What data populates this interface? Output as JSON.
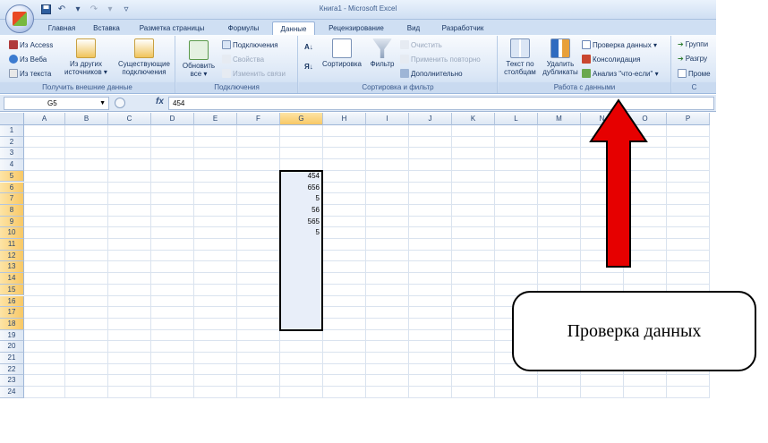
{
  "window": {
    "title": "Книга1 - Microsoft Excel"
  },
  "colors": {
    "accent": "#15325f",
    "selection_fill": "#e8eef9",
    "arrow_red": "#e60000"
  },
  "tabs": [
    {
      "label": "Главная",
      "active": false
    },
    {
      "label": "Вставка",
      "active": false
    },
    {
      "label": "Разметка страницы",
      "active": false
    },
    {
      "label": "Формулы",
      "active": false
    },
    {
      "label": "Данные",
      "active": true
    },
    {
      "label": "Рецензирование",
      "active": false
    },
    {
      "label": "Вид",
      "active": false
    },
    {
      "label": "Разработчик",
      "active": false
    }
  ],
  "ribbon": {
    "external": {
      "access": "Из Access",
      "web": "Из Веба",
      "text": "Из текста",
      "other_l1": "Из других",
      "other_l2": "источников ▾",
      "existing_l1": "Существующие",
      "existing_l2": "подключения",
      "label": "Получить внешние данные"
    },
    "connections": {
      "refresh_l1": "Обновить",
      "refresh_l2": "все ▾",
      "connections": "Подключения",
      "properties": "Свойства",
      "edit_links": "Изменить связи",
      "label": "Подключения"
    },
    "sort": {
      "sort": "Сортировка",
      "filter": "Фильтр",
      "clear": "Очистить",
      "reapply": "Применить повторно",
      "advanced": "Дополнительно",
      "label": "Сортировка и фильтр"
    },
    "datatools": {
      "text_cols_l1": "Текст по",
      "text_cols_l2": "столбцам",
      "remove_dup_l1": "Удалить",
      "remove_dup_l2": "дубликаты",
      "validation": "Проверка данных ▾",
      "consolidate": "Консолидация",
      "whatif": "Анализ \"что-если\" ▾",
      "label": "Работа с данными"
    },
    "outline": {
      "group": "Группи",
      "ungroup": "Разгру",
      "subtotal": "Проме",
      "label": "С"
    }
  },
  "formula_bar": {
    "name_box": "G5",
    "fx": "fx",
    "value": "454"
  },
  "columns": [
    "A",
    "B",
    "C",
    "D",
    "E",
    "F",
    "G",
    "H",
    "I",
    "J",
    "K",
    "L",
    "M",
    "N",
    "O",
    "P"
  ],
  "rows": [
    "1",
    "2",
    "3",
    "4",
    "5",
    "6",
    "7",
    "8",
    "9",
    "10",
    "11",
    "12",
    "13",
    "14",
    "15",
    "16",
    "17",
    "18",
    "19",
    "20",
    "21",
    "22",
    "23",
    "24"
  ],
  "cells": [
    {
      "ref": "G5",
      "value": "454"
    },
    {
      "ref": "G6",
      "value": "656"
    },
    {
      "ref": "G7",
      "value": "5"
    },
    {
      "ref": "G8",
      "value": "56"
    },
    {
      "ref": "G9",
      "value": "565"
    },
    {
      "ref": "G10",
      "value": "5"
    }
  ],
  "annotation": {
    "callout_text": "Проверка данных"
  }
}
